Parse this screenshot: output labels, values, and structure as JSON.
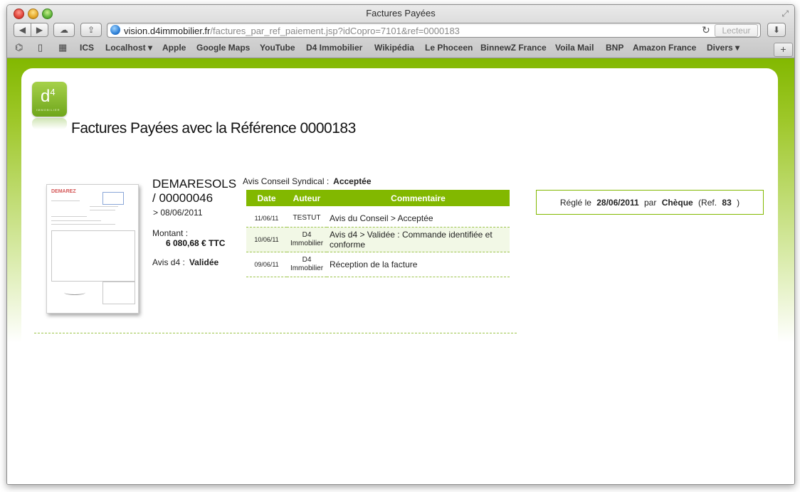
{
  "window": {
    "title": "Factures Payées"
  },
  "toolbar": {
    "back_icon": "◀",
    "forward_icon": "▶",
    "cloud_icon": "☁",
    "share_icon": "⇪",
    "reload_icon": "↻",
    "reader_label": "Lecteur",
    "download_icon": "⬇"
  },
  "address": {
    "domain": "vision.d4immobilier.fr",
    "path": "/factures_par_ref_paiement.jsp?idCopro=7101&ref=0000183"
  },
  "bookmarks": {
    "glasses_icon": "⌬",
    "book_icon": "▯",
    "grid_icon": "▦",
    "items": [
      "ICS",
      "Localhost ▾",
      "Apple",
      "Google Maps",
      "YouTube",
      "D4 Immobilier",
      "Wikipédia",
      "Le Phoceen",
      "BinnewZ France",
      "Voila Mail",
      "BNP",
      "Amazon France",
      "Divers ▾"
    ],
    "plus_icon": "+"
  },
  "logo": {
    "text": "d",
    "sup": "4",
    "sub": "IMMOBILIER"
  },
  "page": {
    "title": "Factures Payées avec la Référence 0000183"
  },
  "thumbnail": {
    "header": "DEMAREZ"
  },
  "invoice": {
    "supplier": "DEMARESOLS / 00000046",
    "date_line": "> 08/06/2011",
    "montant_label": "Montant :",
    "montant_value": "6 080,68 € TTC",
    "avis_d4_label": "Avis d4 :",
    "avis_d4_value": "Validée",
    "avis_cs_label": "Avis Conseil Syndical :",
    "avis_cs_value": "Acceptée"
  },
  "history": {
    "headers": [
      "Date",
      "Auteur",
      "Commentaire"
    ],
    "rows": [
      {
        "date": "11/06/11",
        "auteur": "TESTUT",
        "commentaire": "Avis du Conseil > Acceptée"
      },
      {
        "date": "10/06/11",
        "auteur": "D4 Immobilier",
        "commentaire": "Avis d4 > Validée : Commande identifiée et conforme"
      },
      {
        "date": "09/06/11",
        "auteur": "D4 Immobilier",
        "commentaire": "Réception de la facture"
      }
    ]
  },
  "payment": {
    "prefix": "Réglé le",
    "date": "28/06/2011",
    "par": "par",
    "method": "Chèque",
    "ref_label": "(Ref.",
    "ref_value": "83",
    "ref_close": ")"
  }
}
